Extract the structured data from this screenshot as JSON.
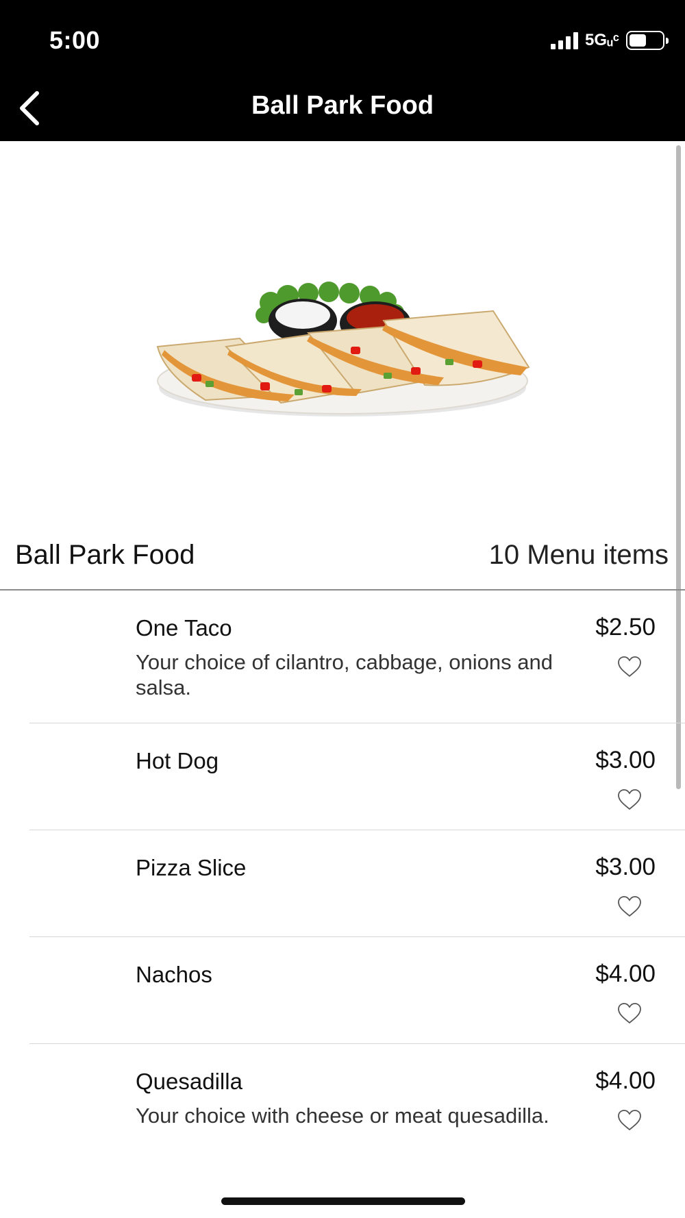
{
  "status_bar": {
    "time": "5:00",
    "network": "5Gᵤᶜ",
    "icons": [
      "signal-icon",
      "battery-icon"
    ]
  },
  "nav": {
    "title": "Ball Park Food",
    "back_icon": "chevron-left-icon"
  },
  "section": {
    "title": "Ball Park Food",
    "count": "10 Menu items"
  },
  "menu_items": [
    {
      "name": "One Taco",
      "price": "$2.50",
      "description": "Your choice of cilantro, cabbage, onions and salsa."
    },
    {
      "name": "Hot Dog",
      "price": "$3.00",
      "description": ""
    },
    {
      "name": "Pizza Slice",
      "price": "$3.00",
      "description": ""
    },
    {
      "name": "Nachos",
      "price": "$4.00",
      "description": ""
    },
    {
      "name": "Quesadilla",
      "price": "$4.00",
      "description": "Your choice with cheese or meat quesadilla."
    }
  ]
}
